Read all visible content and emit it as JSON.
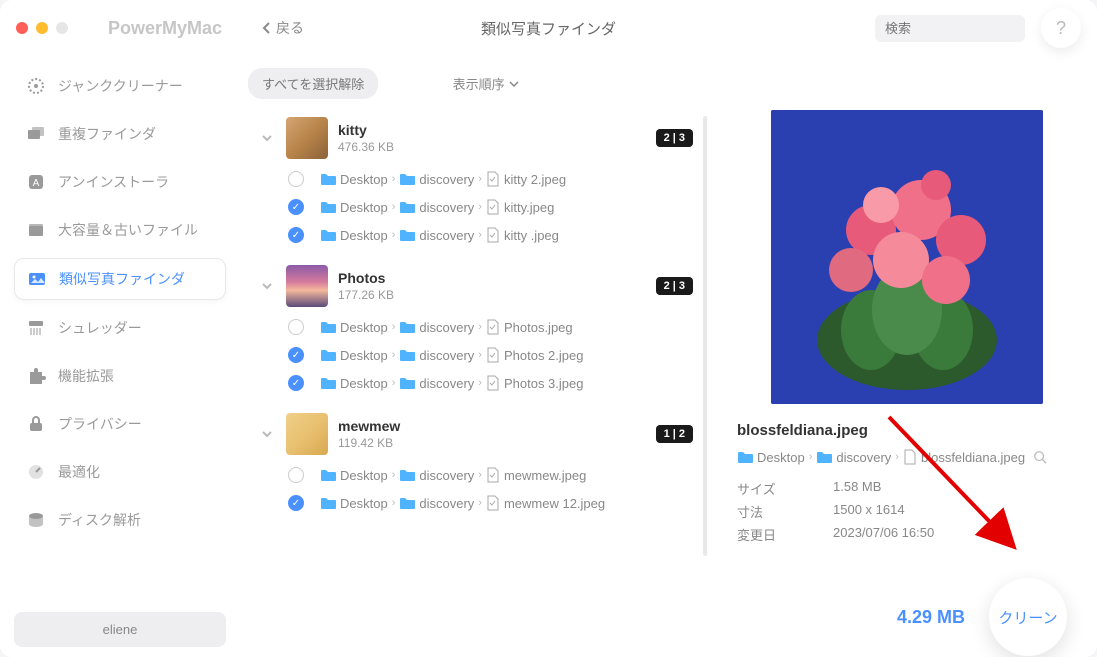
{
  "brand": "PowerMyMac",
  "back_label": "戻る",
  "page_title": "類似写真ファインダ",
  "search": {
    "placeholder": "検索"
  },
  "help_label": "?",
  "sidebar": {
    "items": [
      {
        "label": "ジャンククリーナー"
      },
      {
        "label": "重複ファインダ"
      },
      {
        "label": "アンインストーラ"
      },
      {
        "label": "大容量＆古いファイル"
      },
      {
        "label": "類似写真ファインダ"
      },
      {
        "label": "シュレッダー"
      },
      {
        "label": "機能拡張"
      },
      {
        "label": "プライバシー"
      },
      {
        "label": "最適化"
      },
      {
        "label": "ディスク解析"
      }
    ],
    "user": "eliene"
  },
  "toolbar": {
    "deselect_all": "すべてを選択解除",
    "sort_label": "表示順序"
  },
  "groups": [
    {
      "name": "kitty",
      "size": "476.36 KB",
      "badge": "2 | 3",
      "files": [
        {
          "checked": false,
          "path": [
            "Desktop",
            "discovery"
          ],
          "filename": "kitty 2.jpeg"
        },
        {
          "checked": true,
          "path": [
            "Desktop",
            "discovery"
          ],
          "filename": "kitty.jpeg"
        },
        {
          "checked": true,
          "path": [
            "Desktop",
            "discovery"
          ],
          "filename": "kitty .jpeg"
        }
      ]
    },
    {
      "name": "Photos",
      "size": "177.26 KB",
      "badge": "2 | 3",
      "files": [
        {
          "checked": false,
          "path": [
            "Desktop",
            "discovery"
          ],
          "filename": "Photos.jpeg"
        },
        {
          "checked": true,
          "path": [
            "Desktop",
            "discovery"
          ],
          "filename": "Photos 2.jpeg"
        },
        {
          "checked": true,
          "path": [
            "Desktop",
            "discovery"
          ],
          "filename": "Photos 3.jpeg"
        }
      ]
    },
    {
      "name": "mewmew",
      "size": "119.42 KB",
      "badge": "1 | 2",
      "files": [
        {
          "checked": false,
          "path": [
            "Desktop",
            "discovery"
          ],
          "filename": "mewmew.jpeg"
        },
        {
          "checked": true,
          "path": [
            "Desktop",
            "discovery"
          ],
          "filename": "mewmew 12.jpeg"
        }
      ]
    }
  ],
  "preview": {
    "filename": "blossfeldiana.jpeg",
    "path": [
      "Desktop",
      "discovery",
      "blossfeldiana.jpeg"
    ],
    "meta": {
      "size_label": "サイズ",
      "size_value": "1.58 MB",
      "dim_label": "寸法",
      "dim_value": "1500 x 1614",
      "mod_label": "変更日",
      "mod_value": "2023/07/06 16:50"
    }
  },
  "bottom": {
    "total": "4.29 MB",
    "clean": "クリーン"
  }
}
